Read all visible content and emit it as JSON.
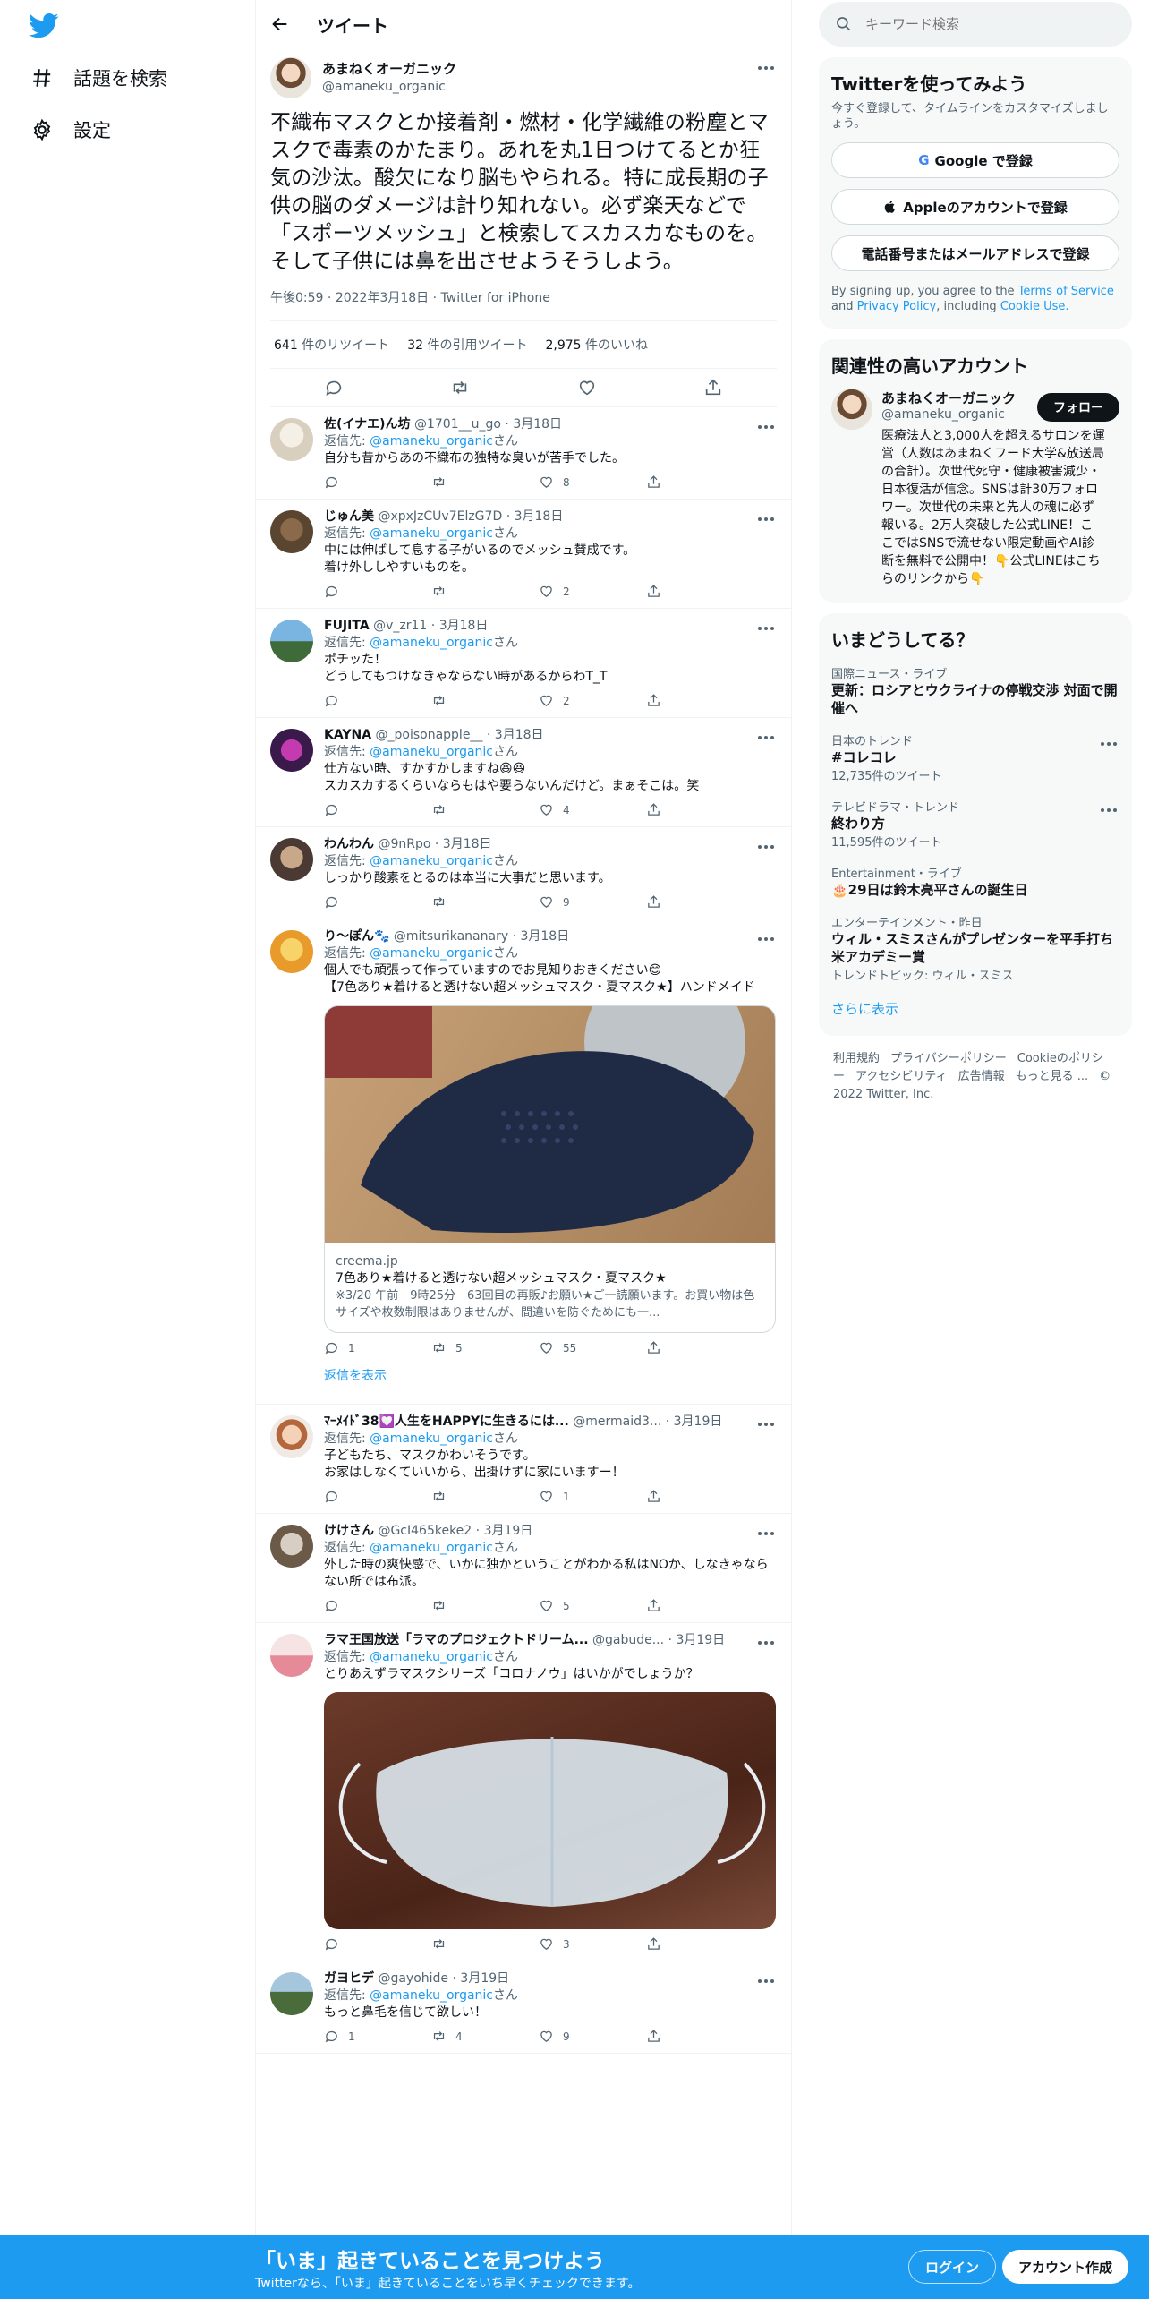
{
  "nav": {
    "explore_label": "話題を検索",
    "settings_label": "設定"
  },
  "header": {
    "title": "ツイート"
  },
  "main_tweet": {
    "name": "あまねくオーガニック",
    "handle": "@amaneku_organic",
    "text": "不織布マスクとか接着剤・燃材・化学繊維の粉塵とマスクで毒素のかたまり。あれを丸1日つけてるとか狂気の沙汰。酸欠になり脳もやられる。特に成長期の子供の脳のダメージは計り知れない。必ず楽天などで「スポーツメッシュ」と検索してスカスカなものを。そして子供には鼻を出させようそうしよう。",
    "time": "午後0:59",
    "date": "2022年3月18日",
    "source": "Twitter for iPhone",
    "retweets": "641",
    "retweets_label": "件のリツイート",
    "quotes": "32",
    "quotes_label": "件の引用ツイート",
    "likes": "2,975",
    "likes_label": "件のいいね"
  },
  "replies": [
    {
      "name": "佐(イナエ)ん坊",
      "handle": "@1701__u_go",
      "date": "3月18日",
      "replying_prefix": "返信先:",
      "replying_to": "@amaneku_organic",
      "replying_suffix": "さん",
      "text": "自分も昔からあの不織布の独特な臭いが苦手でした。",
      "reply_count": "",
      "retweet_count": "",
      "like_count": "8"
    },
    {
      "name": "じゅん美",
      "handle": "@xpxJzCUv7ElzG7D",
      "date": "3月18日",
      "replying_prefix": "返信先:",
      "replying_to": "@amaneku_organic",
      "replying_suffix": "さん",
      "text": "中には伸ばして息する子がいるのでメッシュ賛成です。\n着け外ししやすいものを。",
      "reply_count": "",
      "retweet_count": "",
      "like_count": "2"
    },
    {
      "name": "FUJITA",
      "handle": "@v_zr11",
      "date": "3月18日",
      "replying_prefix": "返信先:",
      "replying_to": "@amaneku_organic",
      "replying_suffix": "さん",
      "text": "ポチッた！\nどうしてもつけなきゃならない時があるからわT_T",
      "reply_count": "",
      "retweet_count": "",
      "like_count": "2"
    },
    {
      "name": "KAYNA",
      "handle": "@_poisonapple__",
      "date": "3月18日",
      "replying_prefix": "返信先:",
      "replying_to": "@amaneku_organic",
      "replying_suffix": "さん",
      "text": "仕方ない時、すかすかしますね😆😆\nスカスカするくらいならもはや要らないんだけど。まぁそこは。笑",
      "reply_count": "",
      "retweet_count": "",
      "like_count": "4"
    },
    {
      "name": "わんわん",
      "handle": "@9nRpo",
      "date": "3月18日",
      "replying_prefix": "返信先:",
      "replying_to": "@amaneku_organic",
      "replying_suffix": "さん",
      "text": "しっかり酸素をとるのは本当に大事だと思います。",
      "reply_count": "",
      "retweet_count": "",
      "like_count": "9"
    },
    {
      "name": "り〜ぽん🐾",
      "handle": "@mitsurikananary",
      "date": "3月18日",
      "replying_prefix": "返信先:",
      "replying_to": "@amaneku_organic",
      "replying_suffix": "さん",
      "text": "個人でも頑張って作っていますのでお見知りおきください😊\n【7色あり★着けると透けない超メッシュマスク・夏マスク★】ハンドメイド",
      "card_domain": "creema.jp",
      "card_title": "7色あり★着けると透けない超メッシュマスク・夏マスク★",
      "card_desc": "※3/20 午前　9時25分　63回目の再販♪お願い★ご一読願います。お買い物は色サイズや枚数制限はありませんが、間違いを防ぐためにも一...",
      "reply_count": "1",
      "retweet_count": "5",
      "like_count": "55",
      "show_replies": "返信を表示"
    },
    {
      "name": "ﾏｰﾒｲﾄﾞ38💟人生をHAPPYに生きるには...",
      "handle": "@mermaid3...",
      "date": "3月19日",
      "replying_prefix": "返信先:",
      "replying_to": "@amaneku_organic",
      "replying_suffix": "さん",
      "text": "子どもたち、マスクかわいそうです。\nお家はしなくていいから、出掛けずに家にいますー！",
      "reply_count": "",
      "retweet_count": "",
      "like_count": "1"
    },
    {
      "name": "けけさん",
      "handle": "@GcI465keke2",
      "date": "3月19日",
      "replying_prefix": "返信先:",
      "replying_to": "@amaneku_organic",
      "replying_suffix": "さん",
      "text": "外した時の爽快感で、いかに独かということがわかる私はNOか、しなきゃならない所では布派。",
      "reply_count": "",
      "retweet_count": "",
      "like_count": "5"
    },
    {
      "name": "ラマ王国放送「ラマのプロジェクトドリーム...",
      "handle": "@gabude...",
      "date": "3月19日",
      "replying_prefix": "返信先:",
      "replying_to": "@amaneku_organic",
      "replying_suffix": "さん",
      "text": "とりあえずラマスクシリーズ「コロナノウ」はいかがでしょうか？",
      "reply_count": "",
      "retweet_count": "",
      "like_count": "3"
    },
    {
      "name": "ガヨヒデ",
      "handle": "@gayohide",
      "date": "3月19日",
      "replying_prefix": "返信先:",
      "replying_to": "@amaneku_organic",
      "replying_suffix": "さん",
      "text": "もっと鼻毛を信じて欲しい！",
      "reply_count": "1",
      "retweet_count": "4",
      "like_count": "9"
    }
  ],
  "right": {
    "search_placeholder": "キーワード検索",
    "signup": {
      "title": "Twitterを使ってみよう",
      "subtitle": "今すぐ登録して、タイムラインをカスタマイズしましょう。",
      "google": "Google で登録",
      "apple": "Appleのアカウントで登録",
      "phone": "電話番号またはメールアドレスで登録",
      "tos_prefix": "By signing up, you agree to the",
      "tos_terms": "Terms of Service",
      "tos_and": "and",
      "tos_privacy": "Privacy Policy",
      "tos_including": ", including",
      "tos_cookie": "Cookie Use."
    },
    "relevant": {
      "title": "関連性の高いアカウント",
      "name": "あまねくオーガニック",
      "handle": "@amaneku_organic",
      "follow": "フォロー",
      "bio": "医療法人と3,000人を超えるサロンを運営（人数はあまねくフード大学&放送局の合計）。次世代死守・健康被害減少・日本復活が信念。SNSは計30万フォロワー。次世代の未来と先人の魂に必ず報いる。2万人突破した公式LINE！ここではSNSで流せない限定動画やAI診断を無料で公開中！👇公式LINEはこちらのリンクから👇"
    },
    "trends": {
      "title": "いまどうしてる？",
      "items": [
        {
          "meta": "国際ニュース・ライブ",
          "title": "更新：ロシアとウクライナの停戦交渉 対面で開催へ",
          "count": ""
        },
        {
          "meta": "日本のトレンド",
          "title": "#コレコレ",
          "count": "12,735件のツイート"
        },
        {
          "meta": "テレビドラマ・トレンド",
          "title": "終わり方",
          "count": "11,595件のツイート"
        },
        {
          "meta": "Entertainment・ライブ",
          "title": "🎂29日は鈴木亮平さんの誕生日",
          "count": ""
        },
        {
          "meta": "エンターテインメント・昨日",
          "title": "ウィル・スミスさんがプレゼンターを平手打ち 米アカデミー賞",
          "count": "トレンドトピック: ウィル・スミス"
        }
      ],
      "show_more": "さらに表示"
    },
    "footer": [
      "利用規約",
      "プライバシーポリシー",
      "Cookieのポリシー",
      "アクセシビリティ",
      "広告情報",
      "もっと見る ...",
      "© 2022 Twitter, Inc."
    ]
  },
  "bottom": {
    "title": "「いま」起きていることを見つけよう",
    "subtitle": "Twitterなら、「いま」起きていることをいち早くチェックできます。",
    "login": "ログイン",
    "signup": "アカウント作成"
  },
  "colors": {
    "accent": "#1d9bf0",
    "text": "#0f1419",
    "muted": "#536471"
  }
}
